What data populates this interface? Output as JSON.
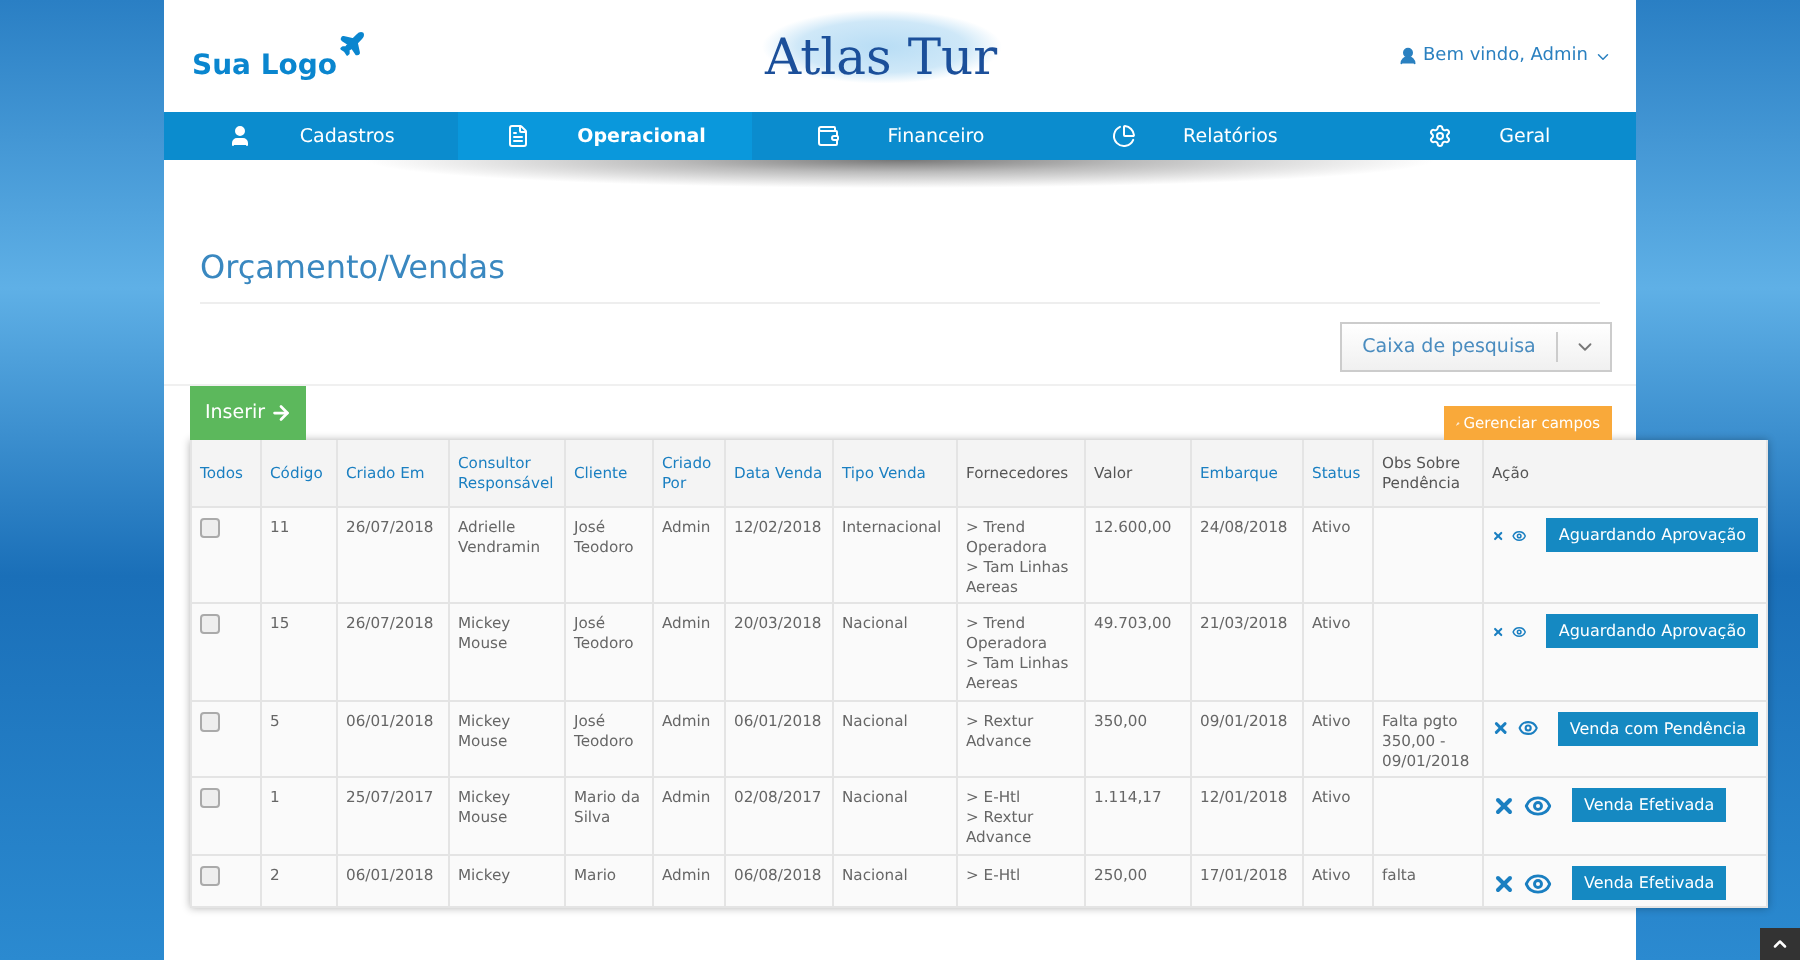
{
  "header": {
    "logo": "Sua Logo",
    "brand": "Atlas Tur",
    "user": "Bem vindo, Admin"
  },
  "nav": [
    {
      "label": "Cadastros",
      "selected": false
    },
    {
      "label": "Operacional",
      "selected": true
    },
    {
      "label": "Financeiro",
      "selected": false
    },
    {
      "label": "Relatórios",
      "selected": false
    },
    {
      "label": "Geral",
      "selected": false
    }
  ],
  "page_title": "Orçamento/Vendas",
  "search": {
    "label": "Caixa de pesquisa"
  },
  "insert_button": "Inserir",
  "manage_button": "Gerenciar campos",
  "table": {
    "columns": [
      {
        "label": "Todos",
        "sortable": true
      },
      {
        "label": "Código",
        "sortable": true
      },
      {
        "label": "Criado Em",
        "sortable": true
      },
      {
        "label": "Consultor Responsável",
        "sortable": true
      },
      {
        "label": "Cliente",
        "sortable": true
      },
      {
        "label": "Criado Por",
        "sortable": true
      },
      {
        "label": "Data Venda",
        "sortable": true
      },
      {
        "label": "Tipo Venda",
        "sortable": true
      },
      {
        "label": "Fornecedores",
        "sortable": false
      },
      {
        "label": "Valor",
        "sortable": false
      },
      {
        "label": "Embarque",
        "sortable": true
      },
      {
        "label": "Status",
        "sortable": true
      },
      {
        "label": "Obs Sobre Pendência",
        "sortable": false
      },
      {
        "label": "Ação",
        "sortable": false
      }
    ],
    "rows": [
      {
        "checked": false,
        "code": "11",
        "created": "26/07/2018",
        "consultant": "Adrielle Vendramin",
        "client": "José Teodoro",
        "created_by": "Admin",
        "sale_date": "12/02/2018",
        "sale_type": "Internacional",
        "suppliers": [
          "> Trend Operadora",
          "> Tam Linhas Aereas"
        ],
        "value": "12.600,00",
        "boarding": "24/08/2018",
        "status": "Ativo",
        "obs": "",
        "action": "Aguardando Aprovação"
      },
      {
        "checked": false,
        "code": "15",
        "created": "26/07/2018",
        "consultant": "Mickey Mouse",
        "client": "José Teodoro",
        "created_by": "Admin",
        "sale_date": "20/03/2018",
        "sale_type": "Nacional",
        "suppliers": [
          "> Trend Operadora",
          "> Tam Linhas Aereas"
        ],
        "value": "49.703,00",
        "boarding": "21/03/2018",
        "status": "Ativo",
        "obs": "",
        "action": "Aguardando Aprovação"
      },
      {
        "checked": false,
        "code": "5",
        "created": "06/01/2018",
        "consultant": "Mickey Mouse",
        "client": "José Teodoro",
        "created_by": "Admin",
        "sale_date": "06/01/2018",
        "sale_type": "Nacional",
        "suppliers": [
          "> Rextur Advance"
        ],
        "value": "350,00",
        "boarding": "09/01/2018",
        "status": "Ativo",
        "obs": "Falta pgto 350,00 - 09/01/2018",
        "action": "Venda com Pendência"
      },
      {
        "checked": false,
        "code": "1",
        "created": "25/07/2017",
        "consultant": "Mickey Mouse",
        "client": "Mario da Silva",
        "created_by": "Admin",
        "sale_date": "02/08/2017",
        "sale_type": "Nacional",
        "suppliers": [
          "> E-Htl",
          "> Rextur Advance"
        ],
        "value": "1.114,17",
        "boarding": "12/01/2018",
        "status": "Ativo",
        "obs": "",
        "action": "Venda Efetivada"
      },
      {
        "checked": false,
        "code": "2",
        "created": "06/01/2018",
        "consultant": "Mickey",
        "client": "Mario",
        "created_by": "Admin",
        "sale_date": "06/08/2018",
        "sale_type": "Nacional",
        "suppliers": [
          "> E-Htl"
        ],
        "value": "250,00",
        "boarding": "17/01/2018",
        "status": "Ativo",
        "obs": "falta",
        "action": "Venda Efetivada"
      }
    ]
  }
}
